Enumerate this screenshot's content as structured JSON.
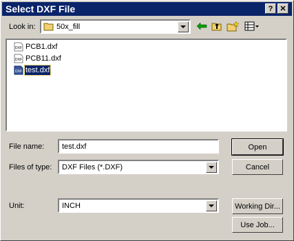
{
  "window": {
    "title": "Select DXF File"
  },
  "lookin": {
    "label": "Look in:",
    "value": "50x_fill"
  },
  "files": [
    "PCB1.dxf",
    "PCB11.dxf",
    "test.dxf"
  ],
  "selected_file": "test.dxf",
  "filename": {
    "label": "File name:",
    "value": "test.dxf"
  },
  "filetype": {
    "label": "Files of type:",
    "value": "DXF Files (*.DXF)"
  },
  "unit": {
    "label": "Unit:",
    "value": "INCH"
  },
  "buttons": {
    "open": "Open",
    "cancel": "Cancel",
    "working_dir": "Working Dir...",
    "use_job": "Use Job..."
  },
  "colors": {
    "titlebar": "#0a246a",
    "face": "#d4d0c8",
    "selection": "#0a246a"
  }
}
